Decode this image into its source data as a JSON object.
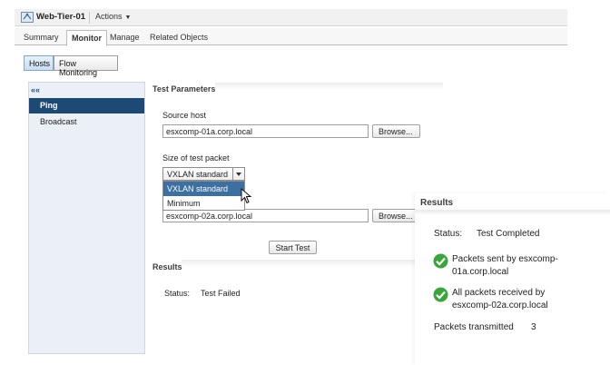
{
  "header": {
    "object_title": "Web-Tier-01",
    "actions_label": "Actions"
  },
  "tabs": [
    {
      "label": "Summary"
    },
    {
      "label": "Monitor"
    },
    {
      "label": "Manage"
    },
    {
      "label": "Related Objects"
    }
  ],
  "subtabs": [
    {
      "label": "Hosts"
    },
    {
      "label": "Flow Monitoring"
    }
  ],
  "nav": {
    "collapse_glyph": "««",
    "items": [
      {
        "label": "Ping"
      },
      {
        "label": "Broadcast"
      }
    ]
  },
  "form": {
    "section_title": "Test Parameters",
    "source_host_label": "Source host",
    "source_host_value": "esxcomp-01a.corp.local",
    "browse_label": "Browse...",
    "packet_size_label": "Size of test packet",
    "packet_size_value": "VXLAN standard",
    "packet_size_options": [
      "VXLAN standard",
      "Minimum"
    ],
    "dest_host_value": "esxcomp-02a.corp.local",
    "start_test_label": "Start Test"
  },
  "results": {
    "title": "Results",
    "status_label": "Status:",
    "status_value": "Test Failed"
  },
  "popup": {
    "title": "Results",
    "status_label": "Status:",
    "status_value": "Test Completed",
    "checks": [
      {
        "line1": "Packets sent by esxcomp-",
        "line2": "01a.corp.local"
      },
      {
        "line1": "All packets received by",
        "line2": "esxcomp-02a.corp.local"
      }
    ],
    "transmitted_label": "Packets transmitted",
    "transmitted_value": "3"
  },
  "colors": {
    "nav_selected": "#1d4a75",
    "dropdown_highlight": "#3d6fa0",
    "check_green": "#3aa63a"
  },
  "icons": {
    "object": "network-object-icon",
    "check": "check-circle-icon",
    "cursor": "mouse-pointer-icon"
  }
}
